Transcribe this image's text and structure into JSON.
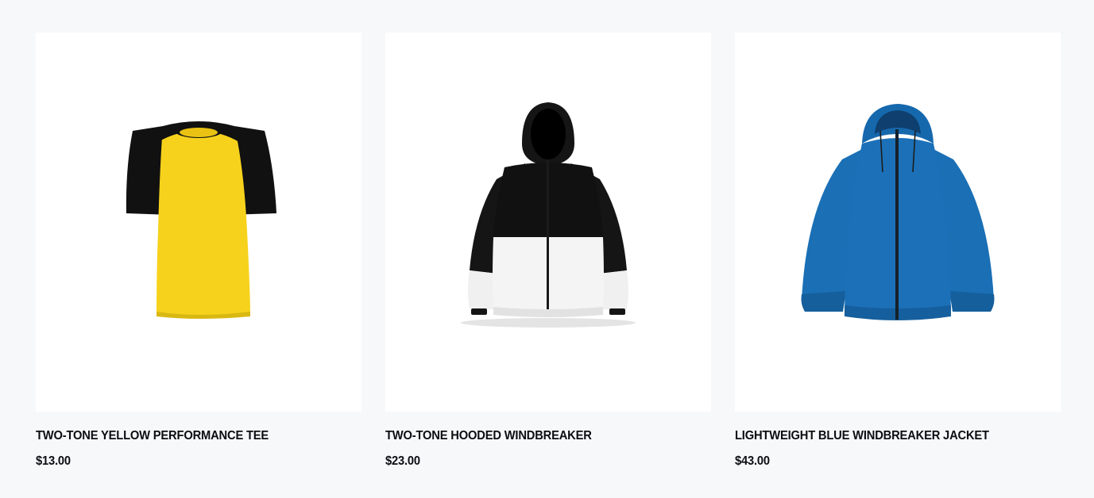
{
  "products": [
    {
      "title": "TWO-TONE YELLOW PERFORMANCE TEE",
      "price": "$13.00",
      "image_icon": "yellow-black-tshirt-icon",
      "colors": {
        "primary": "#f6d21c",
        "secondary": "#111111"
      }
    },
    {
      "title": "TWO-TONE HOODED WINDBREAKER",
      "price": "$23.00",
      "image_icon": "black-white-hooded-windbreaker-icon",
      "colors": {
        "primary": "#111111",
        "secondary": "#f2f2f2"
      }
    },
    {
      "title": "LIGHTWEIGHT BLUE WINDBREAKER JACKET",
      "price": "$43.00",
      "image_icon": "blue-windbreaker-jacket-icon",
      "colors": {
        "primary": "#1a6fb5",
        "secondary": "#0e3f6e"
      }
    }
  ]
}
